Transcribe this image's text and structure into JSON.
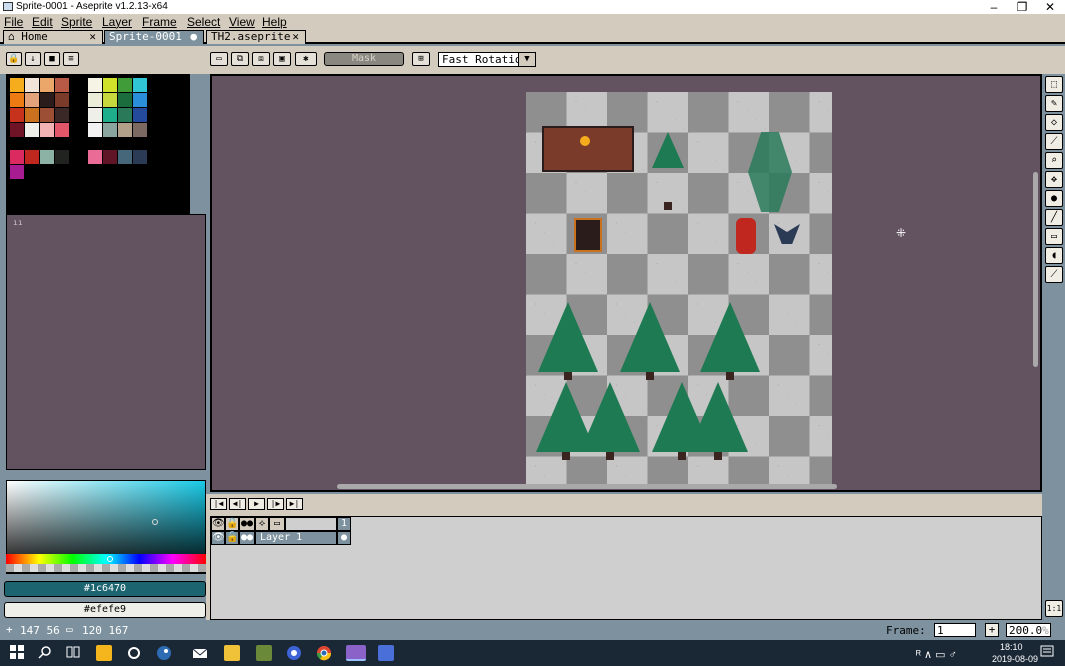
{
  "window": {
    "title": "Sprite-0001 - Aseprite v1.2.13-x64",
    "minimize": "–",
    "maximize": "❐",
    "close": "✕"
  },
  "menu": [
    "File",
    "Edit",
    "Sprite",
    "Layer",
    "Frame",
    "Select",
    "View",
    "Help"
  ],
  "tabs": [
    {
      "label": "Home",
      "icon": "home-icon",
      "close": "✕"
    },
    {
      "label": "Sprite-0001",
      "dot": "●"
    },
    {
      "label": "TH2.aseprite",
      "close": "✕"
    }
  ],
  "toolbar": {
    "mask_label": "Mask",
    "rotation_algorithm": "Fast Rotation",
    "dropdown_arrow": "▼"
  },
  "colors": {
    "foreground_label": "#1c6470",
    "background_label": "#efefe9",
    "foreground": "#1c6470",
    "background": "#efefe9"
  },
  "palette": [
    "#f6ad1d",
    "#f2e4d8",
    "#eba66a",
    "#b95a46",
    "#f5f4e5",
    "#d1e22a",
    "#3f9c38",
    "#31c6d6",
    "#ed7b13",
    "#e2a37c",
    "#2a1c1a",
    "#7a3b2b",
    "#ecedd9",
    "#c7d83f",
    "#1b6d3e",
    "#2b8ed8",
    "#c7321c",
    "#c9711f",
    "#9c4f35",
    "#3a2826",
    "#efefe9",
    "#1eae8b",
    "#2a7a5a",
    "#244a9c",
    "#6e1426",
    "#efefe9",
    "#f3b3b5",
    "#e2566a",
    "#f2f2f2",
    "#8aa59e",
    "#b2a08a",
    "#7c6961",
    "#db2a5f",
    "#c0271e",
    "#8cb1a5",
    "#20231f",
    "#ea6b95",
    "#5f1525",
    "#46677a",
    "#2b3a55",
    "#a71c90"
  ],
  "status": {
    "cursor_pos": "147 56",
    "selection_size": "120 167",
    "frame_label": "Frame:",
    "frame_value": "1",
    "zoom": "200.0",
    "zoom_unit": "%",
    "plus": "+"
  },
  "timeline": {
    "layer_name": "Layer 1",
    "frame_header": "1",
    "cel_marker": "●"
  },
  "side_toggle": "ıı",
  "one_to_one": "1:1",
  "taskbar": {
    "time": "18:10",
    "date": "2019-08-09",
    "tray_glyphs": "ᴿ ∧ ▭ ♂"
  }
}
